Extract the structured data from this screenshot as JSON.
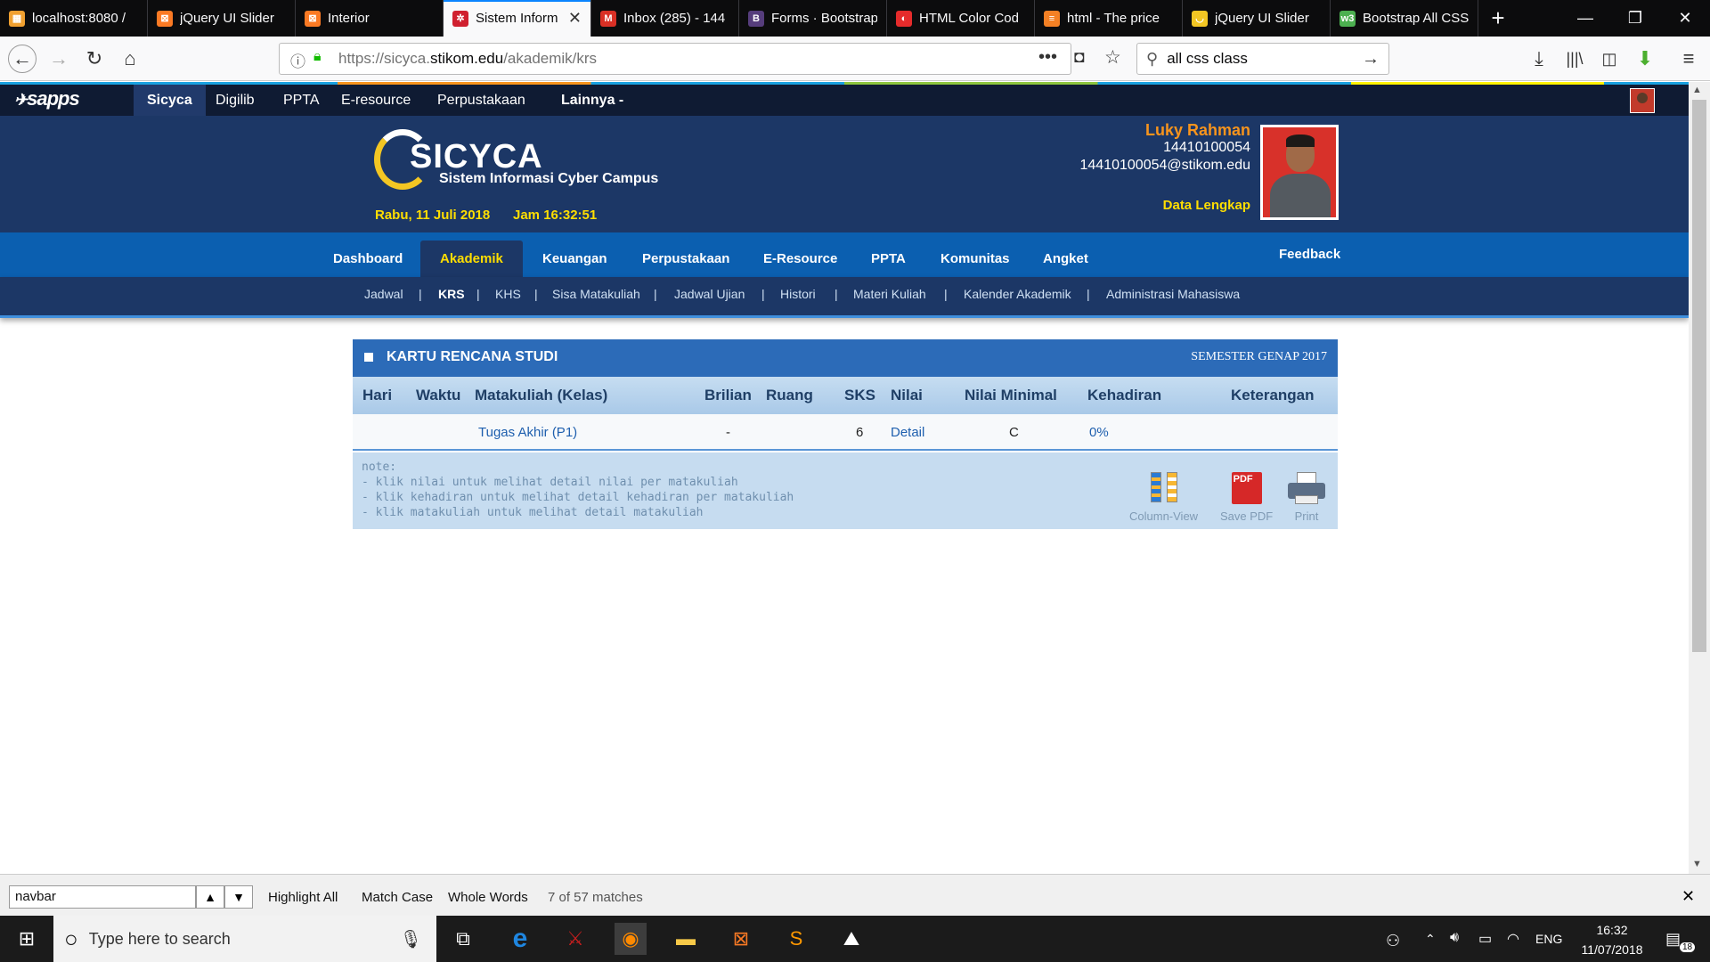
{
  "browser": {
    "tabs": [
      {
        "label": "localhost:8080 / ",
        "icon": "phpmyadmin-icon",
        "color": "#f0a030"
      },
      {
        "label": "jQuery UI Slider",
        "icon": "xampp-icon",
        "color": "#fb7a24"
      },
      {
        "label": "Interior",
        "icon": "xampp-icon",
        "color": "#fb7a24"
      },
      {
        "label": "Sistem Inform",
        "icon": "sicyca-icon",
        "color": "#d0202f"
      },
      {
        "label": "Inbox (285) - 144",
        "icon": "gmail-icon",
        "color": "#d93025"
      },
      {
        "label": "Forms · Bootstrap",
        "icon": "bootstrap-icon",
        "color": "#563d7c"
      },
      {
        "label": "HTML Color Cod",
        "icon": "colorcodes-icon",
        "color": "#e52b2b"
      },
      {
        "label": "html - The price",
        "icon": "stackoverflow-icon",
        "color": "#f48024"
      },
      {
        "label": "jQuery UI Slider",
        "icon": "jquery-icon",
        "color": "#f3c623"
      },
      {
        "label": "Bootstrap All CSS",
        "icon": "w3schools-icon",
        "color": "#4caf50"
      }
    ],
    "active_tab_index": 3,
    "new_tab_symbol": "+",
    "url": {
      "prefix": "https://sicyca.",
      "domain": "stikom.edu",
      "path": "/akademik/krs"
    },
    "search_value": "all css class"
  },
  "site": {
    "brand": "sapps",
    "topnav": [
      "Sicyca",
      "Digilib",
      "PPTA",
      "E-resource",
      "Perpustakaan",
      "Lainnya -"
    ],
    "logo_title": "SICYCA",
    "logo_subtitle": "Sistem Informasi Cyber Campus",
    "date": "Rabu, 11 Juli 2018",
    "time": "Jam 16:32:51",
    "user": {
      "name": "Luky Rahman",
      "nim": "14410100054",
      "email": "14410100054@stikom.edu",
      "link": "Data Lengkap"
    },
    "mainmenu": [
      "Dashboard",
      "Akademik",
      "Keuangan",
      "Perpustakaan",
      "E-Resource",
      "PPTA",
      "Komunitas",
      "Angket"
    ],
    "feedback": "Feedback",
    "submenu": [
      "Jadwal",
      "KRS",
      "KHS",
      "Sisa Matakuliah",
      "Jadwal Ujian",
      "Histori",
      "Materi Kuliah",
      "Kalender Akademik",
      "Administrasi Mahasiswa"
    ],
    "separator": "|"
  },
  "krs": {
    "title": "KARTU RENCANA STUDI",
    "semester": "SEMESTER GENAP 2017",
    "columns": [
      "Hari",
      "Waktu",
      "Matakuliah (Kelas)",
      "Brilian",
      "Ruang",
      "SKS",
      "Nilai",
      "Nilai Minimal",
      "Kehadiran",
      "Keterangan"
    ],
    "rows": [
      {
        "hari": "",
        "waktu": "",
        "matakuliah": "Tugas Akhir (P1)",
        "brilian": "-",
        "ruang": "",
        "sks": "6",
        "nilai": "Detail",
        "nilai_minimal": "C",
        "kehadiran": "0%",
        "keterangan": ""
      }
    ],
    "notes": [
      "note:",
      "- klik nilai untuk melihat detail nilai per matakuliah",
      "- klik kehadiran untuk melihat detail kehadiran per matakuliah",
      "- klik matakuliah untuk melihat detail matakuliah"
    ],
    "actions": [
      "Column-View",
      "Save PDF",
      "Print"
    ]
  },
  "findbar": {
    "query": "navbar",
    "highlight_all": "Highlight All",
    "match_case": "Match Case",
    "whole_words": "Whole Words",
    "matches": "7 of 57 matches"
  },
  "taskbar": {
    "search_placeholder": "Type here to search",
    "lang": "ENG",
    "time": "16:32",
    "date": "11/07/2018",
    "notifications": "18"
  }
}
